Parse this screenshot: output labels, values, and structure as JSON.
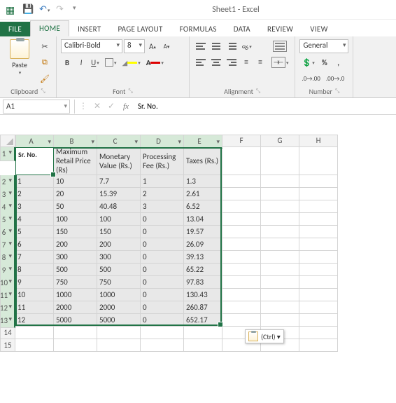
{
  "window": {
    "title": "Sheet1 - Excel"
  },
  "tabs": {
    "file": "FILE",
    "home": "HOME",
    "insert": "INSERT",
    "page_layout": "PAGE LAYOUT",
    "formulas": "FORMULAS",
    "data": "DATA",
    "review": "REVIEW",
    "view": "VIEW"
  },
  "ribbon": {
    "clipboard": {
      "paste": "Paste",
      "title": "Clipboard"
    },
    "font": {
      "name": "Calibri-Bold",
      "size": "8",
      "title": "Font"
    },
    "alignment": {
      "title": "Alignment"
    },
    "number": {
      "format": "General",
      "title": "Number"
    }
  },
  "namebox": "A1",
  "formula": "Sr. No.",
  "columns": [
    "A",
    "B",
    "C",
    "D",
    "E",
    "F",
    "G",
    "H"
  ],
  "headers": {
    "a": "Sr. No.",
    "b": "Maximum Retail Price (Rs)",
    "c": "Monetary Value (Rs.)",
    "d": "Processing Fee (Rs.)",
    "e": "Taxes (Rs.)"
  },
  "rows": [
    {
      "n": "1",
      "a": "1",
      "b": "10",
      "c": "7.7",
      "d": "1",
      "e": "1.3"
    },
    {
      "n": "2",
      "a": "2",
      "b": "20",
      "c": "15.39",
      "d": "2",
      "e": "2.61"
    },
    {
      "n": "3",
      "a": "3",
      "b": "50",
      "c": "40.48",
      "d": "3",
      "e": "6.52"
    },
    {
      "n": "4",
      "a": "4",
      "b": "100",
      "c": "100",
      "d": "0",
      "e": "13.04"
    },
    {
      "n": "5",
      "a": "5",
      "b": "150",
      "c": "150",
      "d": "0",
      "e": "19.57"
    },
    {
      "n": "6",
      "a": "6",
      "b": "200",
      "c": "200",
      "d": "0",
      "e": "26.09"
    },
    {
      "n": "7",
      "a": "7",
      "b": "300",
      "c": "300",
      "d": "0",
      "e": "39.13"
    },
    {
      "n": "8",
      "a": "8",
      "b": "500",
      "c": "500",
      "d": "0",
      "e": "65.22"
    },
    {
      "n": "9",
      "a": "9",
      "b": "750",
      "c": "750",
      "d": "0",
      "e": "97.83"
    },
    {
      "n": "10",
      "a": "10",
      "b": "1000",
      "c": "1000",
      "d": "0",
      "e": "130.43"
    },
    {
      "n": "11",
      "a": "11",
      "b": "2000",
      "c": "2000",
      "d": "0",
      "e": "260.87"
    },
    {
      "n": "12",
      "a": "12",
      "b": "5000",
      "c": "5000",
      "d": "0",
      "e": "652.17"
    }
  ],
  "pasteopts": "(Ctrl) ▾",
  "dialog_glyph": "⤡"
}
